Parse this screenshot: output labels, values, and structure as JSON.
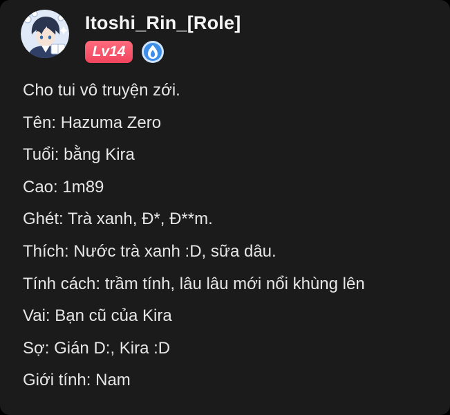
{
  "post": {
    "username": "Itoshi_Rin_[Role]",
    "level_badge": "Lv14",
    "colors": {
      "card_background": "#1b1b1b",
      "level_badge": "#f0455e",
      "title_badge": "#3d8ee8",
      "text": "#e6e6e6"
    },
    "icons": {
      "avatar": "anime-character-avatar",
      "title_badge": "blue-flame-badge-icon"
    },
    "bio_lines": [
      "Cho tui vô truyện zới.",
      "Tên: Hazuma Zero",
      "Tuổi: bằng Kira",
      "Cao: 1m89",
      "Ghét: Trà xanh, Đ*, Đ**m.",
      "Thích: Nước trà xanh :D, sữa dâu.",
      "Tính cách: trầm tính, lâu lâu mới nổi khùng lên",
      "Vai: Bạn cũ của Kira",
      "Sợ: Gián D:, Kira :D",
      "Giới tính: Nam"
    ]
  }
}
